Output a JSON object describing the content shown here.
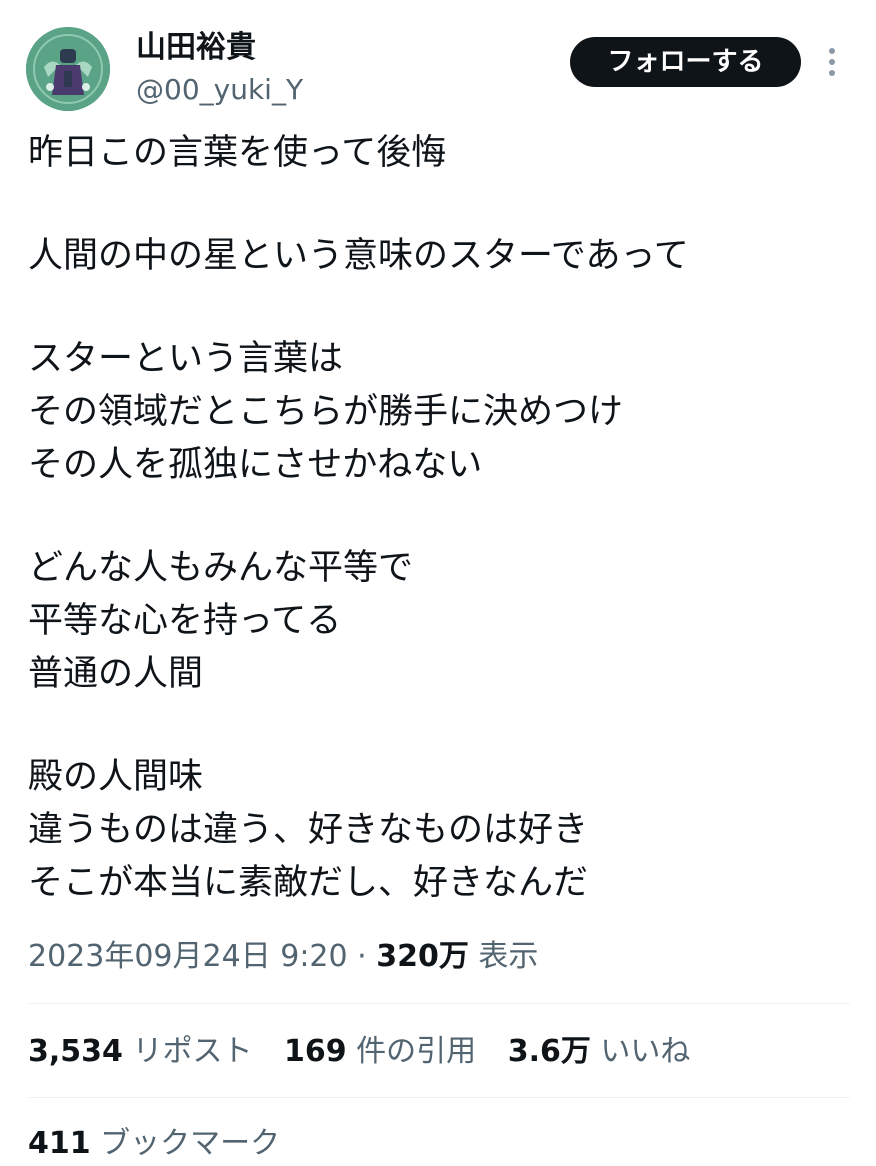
{
  "user": {
    "display_name": "山田裕貴",
    "handle": "@00_yuki_Y"
  },
  "follow_label": "フォローする",
  "more_icon": "more-vertical-icon",
  "avatar_icon": "profile-avatar",
  "tweet": {
    "paragraphs": [
      [
        "昨日この言葉を使って後悔"
      ],
      [
        "人間の中の星という意味のスターであって"
      ],
      [
        "スターという言葉は",
        "その領域だとこちらが勝手に決めつけ",
        "その人を孤独にさせかねない"
      ],
      [
        "どんな人もみんな平等で",
        "平等な心を持ってる",
        "普通の人間"
      ],
      [
        "殿の人間味",
        "違うものは違う、好きなものは好き",
        "そこが本当に素敵だし、好きなんだ"
      ]
    ]
  },
  "meta": {
    "datetime": "2023年09月24日 9:20",
    "separator": " · ",
    "views_count": "320万",
    "views_label": "表示"
  },
  "stats": {
    "reposts_count": "3,534",
    "reposts_label": "リポスト",
    "quotes_count": "169",
    "quotes_label": "件の引用",
    "likes_count": "3.6万",
    "likes_label": "いいね",
    "bookmarks_count": "411",
    "bookmarks_label": "ブックマーク"
  },
  "colors": {
    "text": "#0f1419",
    "secondary": "#536471",
    "divider": "#eff3f4",
    "avatar_bg": "#4f9a7a"
  }
}
